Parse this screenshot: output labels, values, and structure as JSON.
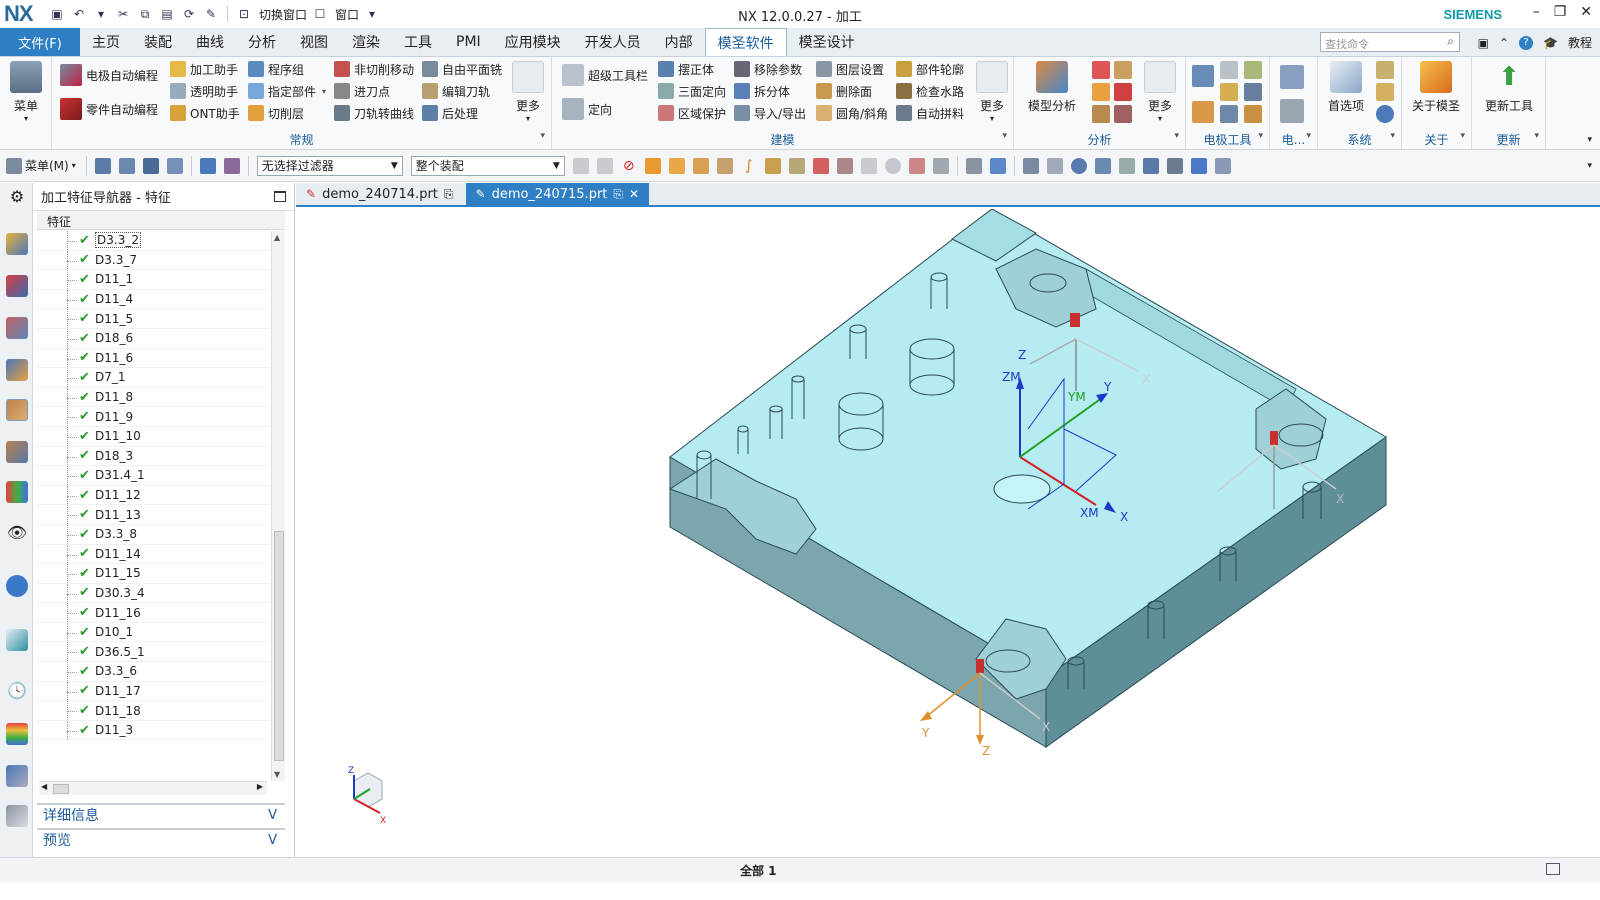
{
  "app": {
    "logo": "NX",
    "title": "NX 12.0.0.27 - 加工",
    "brand": "SIEMENS",
    "quick_access": {
      "switch_window": "切换窗口",
      "window": "窗口"
    },
    "window_controls": {
      "minimize": "–",
      "restore": "❐",
      "close": "✕"
    }
  },
  "menubar": {
    "file": "文件(F)",
    "tabs": [
      "主页",
      "装配",
      "曲线",
      "分析",
      "视图",
      "渲染",
      "工具",
      "PMI",
      "应用模块",
      "开发人员",
      "内部",
      "模圣软件",
      "模圣设计"
    ],
    "active_tab": "模圣软件",
    "search_placeholder": "查找命令",
    "tutorial": "教程"
  },
  "ribbon": {
    "menu_button": "菜单",
    "group_normal": {
      "label": "常规",
      "items": [
        "电极自动编程",
        "零件自动编程",
        "加工助手",
        "透明助手",
        "ONT助手",
        "程序组",
        "指定部件",
        "切削层",
        "非切削移动",
        "进刀点",
        "刀轨转曲线",
        "自由平面铣",
        "编辑刀轨",
        "后处理"
      ],
      "more": "更多"
    },
    "group_model": {
      "label": "建模",
      "items": [
        "超级工具栏",
        "定向",
        "摆正体",
        "三面定向",
        "区域保护",
        "移除参数",
        "拆分体",
        "导入/导出",
        "图层设置",
        "删除面",
        "圆角/斜角",
        "部件轮廓",
        "检查水路",
        "自动拼料"
      ],
      "more": "更多"
    },
    "group_analysis": {
      "label": "分析",
      "model_analysis": "模型分析",
      "more": "更多"
    },
    "group_electrode": {
      "label": "电极工具"
    },
    "group_e": {
      "label": "电..."
    },
    "group_system": {
      "label": "系统",
      "preferences": "首选项"
    },
    "group_about": {
      "label": "关于",
      "about": "关于模圣"
    },
    "group_update": {
      "label": "更新",
      "update_tool": "更新工具"
    }
  },
  "toolbar": {
    "menu": "菜单(M)",
    "filter": "无选择过滤器",
    "scope": "整个装配"
  },
  "navigator": {
    "title": "加工特征导航器 - 特征",
    "column": "特征",
    "features": [
      "D3.3_2",
      "D3.3_7",
      "D11_1",
      "D11_4",
      "D11_5",
      "D18_6",
      "D11_6",
      "D7_1",
      "D11_8",
      "D11_9",
      "D11_10",
      "D18_3",
      "D31.4_1",
      "D11_12",
      "D11_13",
      "D3.3_8",
      "D11_14",
      "D11_15",
      "D30.3_4",
      "D11_16",
      "D10_1",
      "D36.5_1",
      "D3.3_6",
      "D11_17",
      "D11_18",
      "D11_3"
    ],
    "selected": "D3.3_2",
    "details": "详细信息",
    "preview": "预览"
  },
  "doc_tabs": [
    {
      "name": "demo_240714.prt",
      "active": false
    },
    {
      "name": "demo_240715.prt",
      "active": true
    }
  ],
  "viewport": {
    "axis_labels": {
      "x": "X",
      "y": "Y",
      "z": "Z",
      "xm": "XM",
      "ym": "YM",
      "zm": "ZM"
    },
    "colors": {
      "part_top": "#b5ecf2",
      "part_side": "#6a9aa4",
      "part_edge": "#2c4a52",
      "background": "#ffffff"
    }
  },
  "status": {
    "text": "全部 1"
  },
  "colors": {
    "accent": "#2f7fc4",
    "ribbon_label": "#1d5c99",
    "check": "#2a9a2a"
  }
}
